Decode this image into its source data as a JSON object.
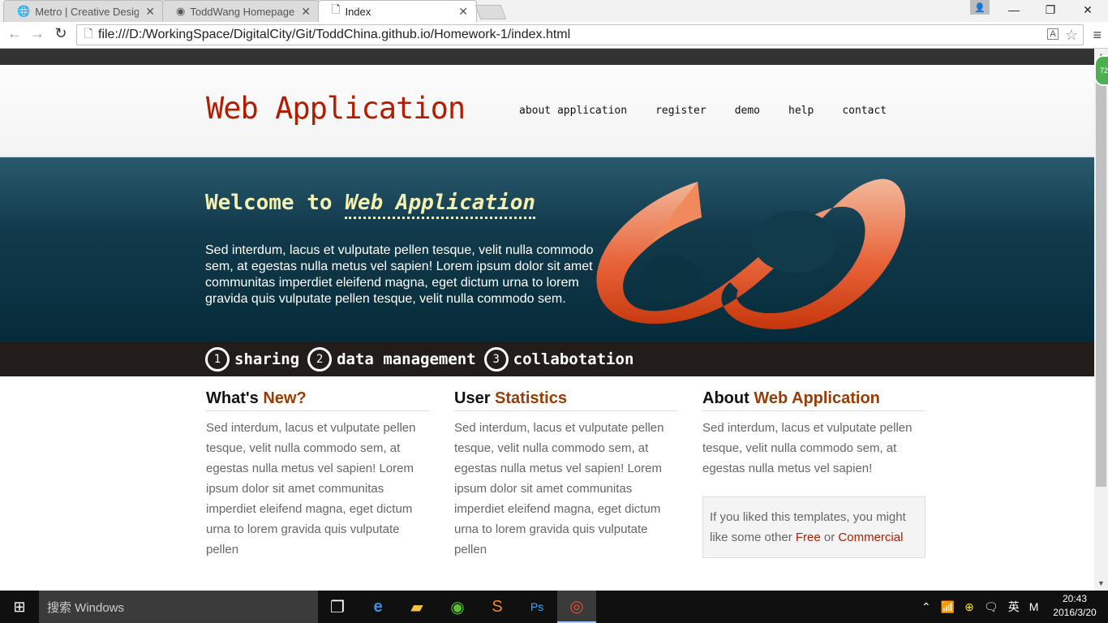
{
  "browser": {
    "tabs": [
      {
        "title": "Metro | Creative Design"
      },
      {
        "title": "ToddWang Homepage"
      },
      {
        "title": "Index"
      }
    ],
    "url": "file:///D:/WorkingSpace/DigitalCity/Git/ToddChina.github.io/Homework-1/index.html",
    "extension_badge": "72"
  },
  "site": {
    "logo": "Web Application",
    "nav": [
      "about application",
      "register",
      "demo",
      "help",
      "contact"
    ],
    "welcome_prefix": "Welcome to",
    "welcome_highlight": "Web Application",
    "intro": "Sed interdum, lacus et vulputate pellen tesque, velit nulla commodo sem, at egestas nulla metus vel sapien! Lorem ipsum dolor sit amet communitas imperdiet eleifend magna, eget dictum urna to lorem gravida quis vulputate pellen tesque, velit nulla commodo sem.",
    "steps": [
      {
        "num": "1",
        "label": "sharing"
      },
      {
        "num": "2",
        "label": "data management"
      },
      {
        "num": "3",
        "label": "collabotation"
      }
    ],
    "columns": [
      {
        "title_plain": "What's",
        "title_accent": "New?",
        "text": "Sed interdum, lacus et vulputate pellen tesque, velit nulla commodo sem, at egestas nulla metus vel sapien! Lorem ipsum dolor sit amet communitas imperdiet eleifend magna, eget dictum urna to lorem gravida quis vulputate pellen"
      },
      {
        "title_plain": "User",
        "title_accent": "Statistics",
        "text": "Sed interdum, lacus et vulputate pellen tesque, velit nulla commodo sem, at egestas nulla metus vel sapien! Lorem ipsum dolor sit amet communitas imperdiet eleifend magna, eget dictum urna to lorem gravida quis vulputate pellen"
      },
      {
        "title_plain": "About",
        "title_accent": "Web Application",
        "text": "Sed interdum, lacus et vulputate pellen tesque, velit nulla commodo sem, at egestas nulla metus vel sapien!"
      }
    ],
    "callout": {
      "before": "If you liked this templates, you might like some other ",
      "link1": "Free",
      "middle": " or ",
      "link2": "Commercial"
    }
  },
  "taskbar": {
    "search_placeholder": "搜索 Windows",
    "ime_label": "英",
    "ime_mode": "M",
    "time": "20:43",
    "date": "2016/3/20"
  },
  "colors": {
    "brand": "#b11e00",
    "accent": "#9a3b05",
    "banner": "#113a4b"
  }
}
